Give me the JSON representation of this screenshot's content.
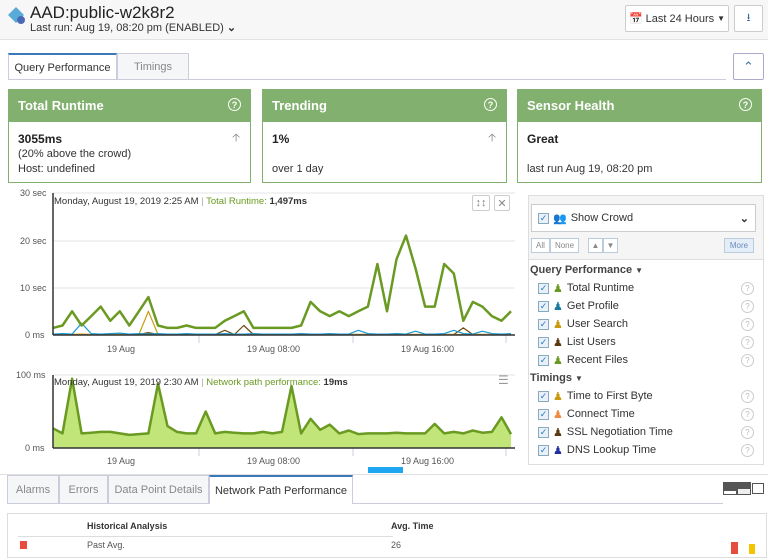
{
  "header": {
    "title": "AAD:public-w2k8r2",
    "subtitle": "Last run: Aug 19, 08:20 pm (ENABLED)",
    "range_label": "Last 24 Hours"
  },
  "tabs": [
    {
      "label": "Query Performance",
      "active": true
    },
    {
      "label": "Timings",
      "active": false
    }
  ],
  "cards": [
    {
      "title": "Total Runtime",
      "value": "3055ms",
      "line2": "(20% above the crowd)",
      "line3": "Host: undefined",
      "trend": "up"
    },
    {
      "title": "Trending",
      "value": "1%",
      "line2": "",
      "line3": "over 1 day",
      "trend": "up"
    },
    {
      "title": "Sensor Health",
      "value": "Great",
      "line2": "",
      "line3": "last run Aug 19, 08:20 pm"
    }
  ],
  "chart_data": [
    {
      "type": "line",
      "tooltip_date": "Monday, August 19, 2019 2:25 AM",
      "tooltip_series": "Total Runtime:",
      "tooltip_value": "1,497ms",
      "y_ticks": [
        "30 sec",
        "20 sec",
        "10 sec",
        "0 ms"
      ],
      "ylim": [
        0,
        30
      ],
      "yunit": "sec",
      "x_ticks": [
        "19 Aug",
        "19 Aug 08:00",
        "19 Aug 16:00"
      ],
      "x_range": [
        "18 Aug 20:20",
        "19 Aug 20:20"
      ],
      "x_step_minutes": 30,
      "series": [
        {
          "name": "Total Runtime",
          "color": "#6a9a22",
          "values": [
            1.5,
            2,
            5,
            2,
            4,
            6,
            3,
            5,
            2,
            5,
            8,
            2,
            1.5,
            1.5,
            2,
            1.5,
            1.5,
            1.5,
            3,
            4,
            5,
            1.5,
            1.5,
            1.5,
            1.5,
            1.5,
            2,
            7,
            5,
            4,
            5,
            4,
            5,
            6,
            15,
            5,
            16,
            21,
            14,
            6,
            6,
            15,
            13,
            3,
            7,
            6,
            4,
            3,
            5
          ]
        },
        {
          "name": "Get Profile",
          "color": "#1a9ad0",
          "values": [
            0.2,
            0.3,
            0.2,
            2.5,
            0.3,
            0.2,
            0.3,
            0.4,
            0.2,
            0.3,
            0.2,
            0.3,
            0.2,
            0.2,
            0.3,
            0.2,
            0.2,
            0.2,
            0.3,
            0.2,
            0.2,
            0.3,
            0.2,
            0.2,
            0.2,
            0.2,
            0.3,
            0.2,
            0.2,
            0.3,
            0.2,
            0.2,
            1,
            0.3,
            0.2,
            0.2,
            0.3,
            0.2,
            0.8,
            0.2,
            0.2,
            0.3,
            1,
            0.3,
            0.2,
            0.8,
            0.3,
            0.2,
            0.3
          ]
        },
        {
          "name": "User Search",
          "color": "#c99a10",
          "values": [
            0.1,
            0.1,
            0.1,
            0.2,
            0.1,
            0.1,
            0.1,
            0.1,
            0.1,
            0.1,
            5,
            0.1,
            0.1,
            0.1,
            0.1,
            0.1,
            0.1,
            0.1,
            0.2,
            0.1,
            0.1,
            0.1,
            0.1,
            0.1,
            0.1,
            0.1,
            0.1,
            0.1,
            0.1,
            0.1,
            0.1,
            0.1,
            0.1,
            0.1,
            0.1,
            0.1,
            0.1,
            0.1,
            0.1,
            0.1,
            0.1,
            0.1,
            0.1,
            0.1,
            0.1,
            0.1,
            0.1,
            0.1,
            0.1
          ]
        },
        {
          "name": "List Users",
          "color": "#6b4a10",
          "values": [
            0.1,
            0.1,
            0.1,
            0.1,
            0.1,
            0.1,
            0.1,
            0.1,
            0.1,
            0.1,
            0.5,
            0.1,
            0.1,
            0.1,
            0.1,
            0.1,
            0.1,
            0.1,
            1,
            0.1,
            2,
            0.1,
            0.1,
            0.1,
            0.1,
            0.1,
            0.1,
            0.1,
            0.1,
            0.1,
            0.1,
            0.1,
            0.1,
            0.1,
            0.1,
            0.1,
            0.1,
            0.1,
            0.1,
            0.1,
            0.1,
            0.1,
            0.1,
            1.5,
            0.1,
            0.1,
            0.1,
            0.1,
            0.1
          ]
        }
      ]
    },
    {
      "type": "area",
      "tooltip_date": "Monday, August 19, 2019 2:30 AM",
      "tooltip_series": "Network path performance:",
      "tooltip_value": "19ms",
      "y_ticks": [
        "100 ms",
        "0 ms"
      ],
      "ylim": [
        0,
        100
      ],
      "yunit": "ms",
      "x_ticks": [
        "19 Aug",
        "19 Aug 08:00",
        "19 Aug 16:00"
      ],
      "x_range": [
        "18 Aug 20:20",
        "19 Aug 20:20"
      ],
      "x_step_minutes": 30,
      "series": [
        {
          "name": "Network path performance",
          "color": "#6a9a22",
          "fill": "#c2e57a",
          "values": [
            27,
            20,
            95,
            20,
            21,
            22,
            22,
            20,
            18,
            19,
            20,
            88,
            30,
            22,
            20,
            20,
            50,
            20,
            22,
            21,
            20,
            20,
            22,
            20,
            22,
            85,
            20,
            40,
            25,
            32,
            20,
            24,
            19,
            20,
            20,
            20,
            21,
            20,
            20,
            20,
            33,
            20,
            22,
            20,
            24,
            21,
            22,
            42,
            19
          ]
        }
      ]
    }
  ],
  "panel": {
    "crowd_label": "Show Crowd",
    "all": "All",
    "none": "None",
    "more": "More",
    "groups": [
      {
        "label": "Query Performance",
        "items": [
          {
            "label": "Total Runtime",
            "color": "#6a9a22"
          },
          {
            "label": "Get Profile",
            "color": "#1a7aa0"
          },
          {
            "label": "User Search",
            "color": "#c99a10"
          },
          {
            "label": "List Users",
            "color": "#5a3a10"
          },
          {
            "label": "Recent Files",
            "color": "#6a9a22"
          }
        ]
      },
      {
        "label": "Timings",
        "items": [
          {
            "label": "Time to First Byte",
            "color": "#c99a10"
          },
          {
            "label": "Connect Time",
            "color": "#f08a40"
          },
          {
            "label": "SSL Negotiation Time",
            "color": "#5a3a10"
          },
          {
            "label": "DNS Lookup Time",
            "color": "#2030a0"
          }
        ]
      }
    ]
  },
  "bottom_tabs": [
    {
      "label": "Alarms"
    },
    {
      "label": "Errors"
    },
    {
      "label": "Data Point Details"
    },
    {
      "label": "Network Path Performance",
      "active": true
    }
  ],
  "table": {
    "headers": [
      "Historical Analysis",
      "Avg. Time"
    ],
    "rows": [
      {
        "label": "Past Avg.",
        "value": "26",
        "color": "#e74c3c"
      }
    ]
  }
}
